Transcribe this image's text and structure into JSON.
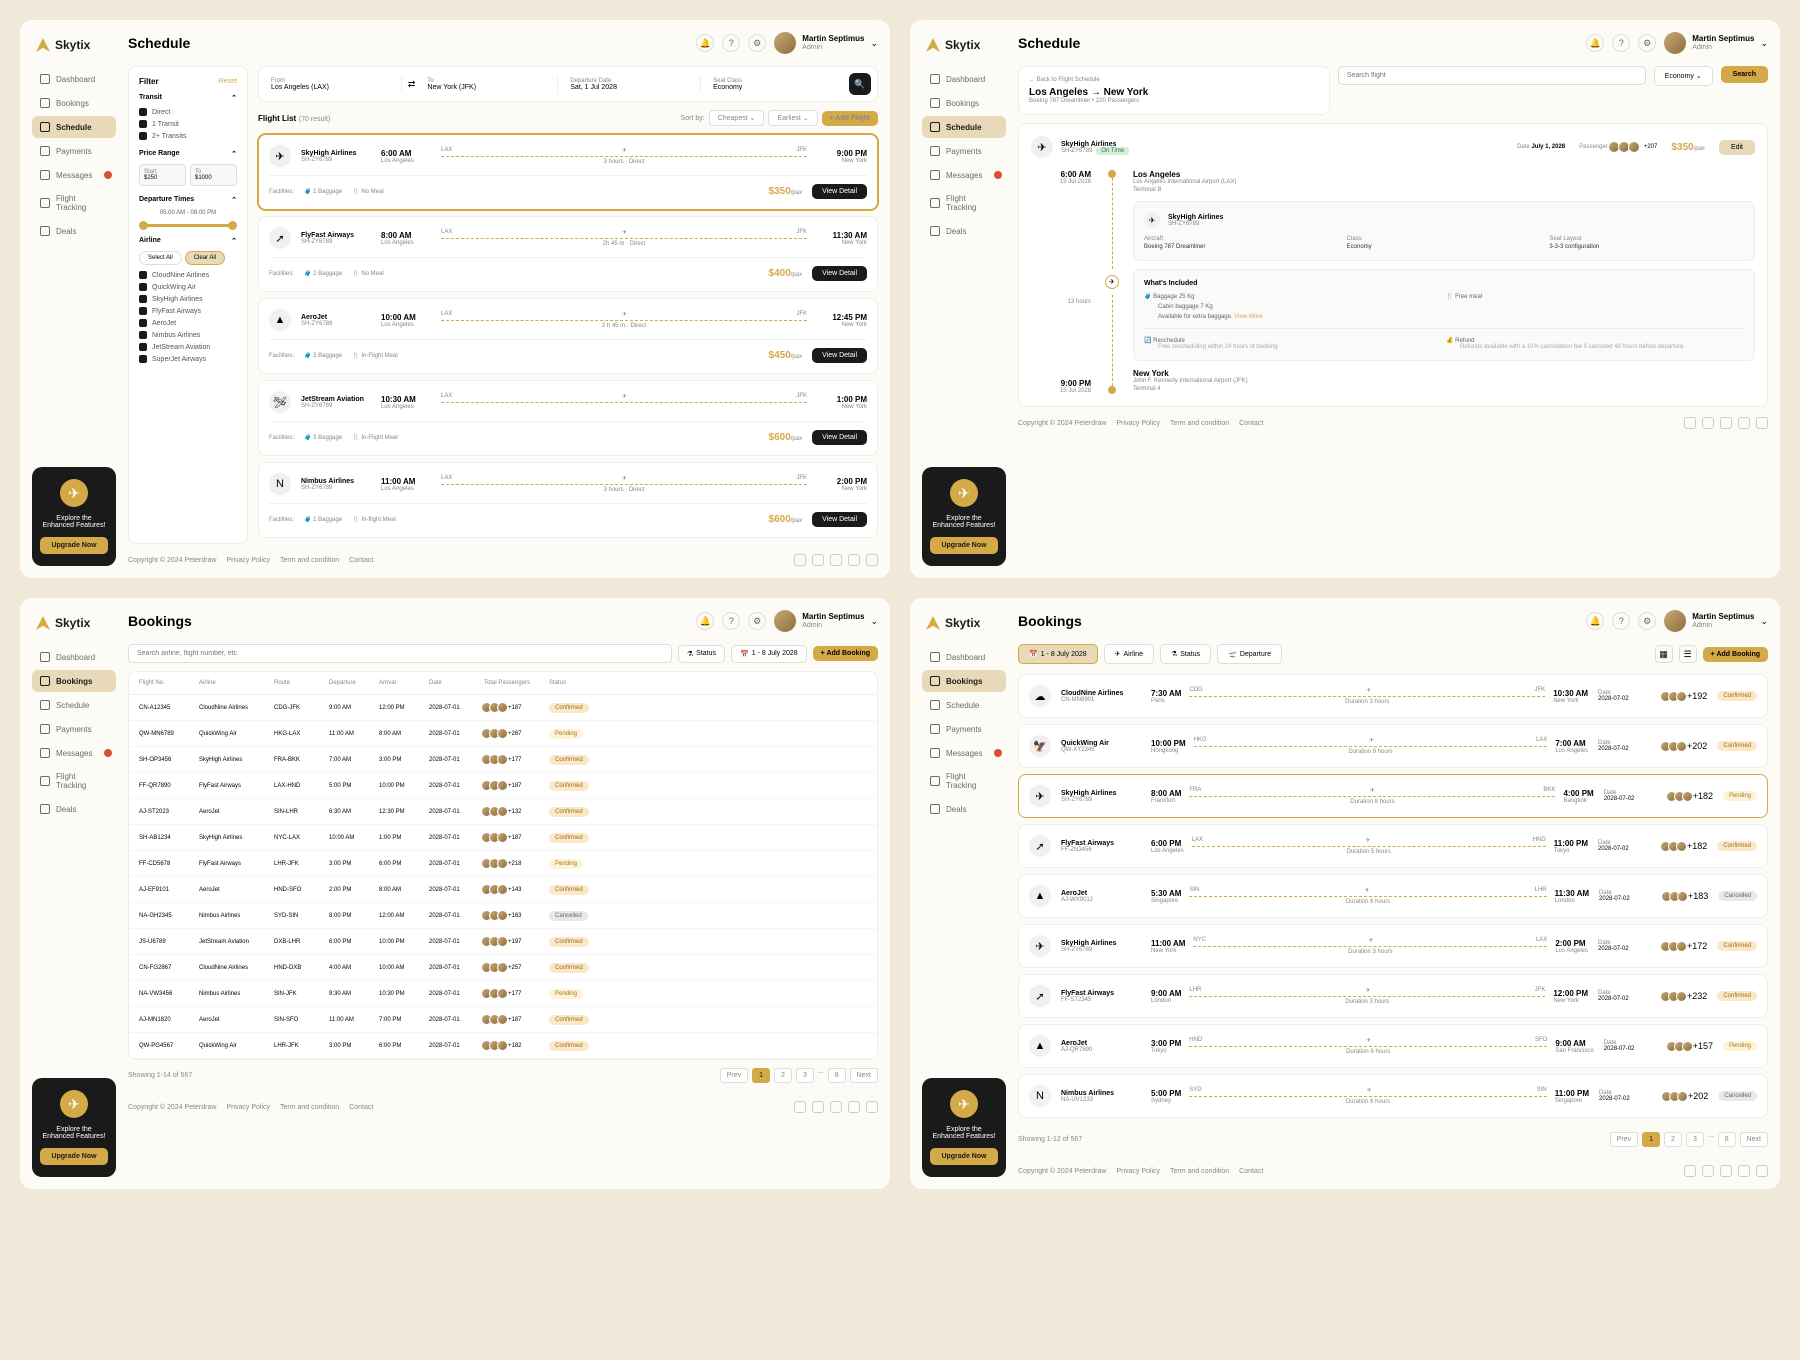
{
  "brand": "Skytix",
  "user": {
    "name": "Martin Septimus",
    "role": "Admin"
  },
  "nav": {
    "dashboard": "Dashboard",
    "bookings": "Bookings",
    "schedule": "Schedule",
    "payments": "Payments",
    "messages": "Messages",
    "flightTracking": "Flight Tracking",
    "deals": "Deals"
  },
  "promo": {
    "title": "Explore the Enhanced Features!",
    "cta": "Upgrade Now"
  },
  "footer": {
    "copyright": "Copyright © 2024 Peterdraw",
    "privacy": "Privacy Policy",
    "terms": "Term and condition",
    "contact": "Contact"
  },
  "schedule": {
    "title": "Schedule",
    "search": {
      "fromLabel": "From",
      "fromValue": "Los Angeles (LAX)",
      "toLabel": "To",
      "toValue": "New York (JFK)",
      "dateLabel": "Departure Date",
      "dateValue": "Sat, 1 Jul 2028",
      "classLabel": "Seat Class",
      "classValue": "Economy"
    },
    "filter": {
      "title": "Filter",
      "reset": "Reset",
      "transit": {
        "title": "Transit",
        "direct": "Direct",
        "one": "1 Transit",
        "two": "2+ Transits"
      },
      "priceRange": {
        "title": "Price Range",
        "startLabel": "Start",
        "start": "$250",
        "endLabel": "To",
        "end": "$1000"
      },
      "depTimes": {
        "title": "Departure Times",
        "range": "05.00 AM - 08.00 PM"
      },
      "airline": {
        "title": "Airline",
        "selectAll": "Select All",
        "clearAll": "Clear All",
        "items": [
          "CloudNine Airlines",
          "QuickWing Air",
          "SkyHigh Airlines",
          "FlyFast Airways",
          "AeroJet",
          "Nimbus Airlines",
          "JetStream Aviation",
          "SuperJet Airways"
        ]
      }
    },
    "list": {
      "title": "Flight List",
      "countLabel": "(70 result)",
      "sortLabel": "Sort by:",
      "cheapest": "Cheapest",
      "earliest": "Earliest",
      "addFlight": "+ Add Flight",
      "facilitiesLabel": "Facilities:",
      "flights": [
        {
          "logo": "✈",
          "name": "SkyHigh Airlines",
          "code": "SH-ZY6789",
          "depTime": "6:00 AM",
          "depCity": "Los Angeles",
          "arrTime": "9:00 PM",
          "arrCity": "New York",
          "from": "LAX",
          "to": "JFK",
          "duration": "3 hours",
          "stops": "Direct",
          "price": "$350",
          "bag": "1 Baggage",
          "meal": "No Meal",
          "h": true
        },
        {
          "logo": "➚",
          "name": "FlyFast Airways",
          "code": "SH-ZY6789",
          "depTime": "8:00 AM",
          "depCity": "Los Angeles",
          "arrTime": "11:30 AM",
          "arrCity": "New York",
          "from": "LAX",
          "to": "JFK",
          "duration": "2h 45 m",
          "stops": "Direct",
          "price": "$400",
          "bag": "2 Baggage",
          "meal": "No Meal"
        },
        {
          "logo": "▲",
          "name": "AeroJet",
          "code": "SH-ZY6789",
          "depTime": "10:00 AM",
          "depCity": "Los Angeles",
          "arrTime": "12:45 PM",
          "arrCity": "New York",
          "from": "LAX",
          "to": "JFK",
          "duration": "2 h 45 m",
          "stops": "Direct",
          "price": "$450",
          "bag": "3 Baggage",
          "meal": "In-Flight Meal"
        },
        {
          "logo": "🛩",
          "name": "JetStream Aviation",
          "code": "SH-ZY6789",
          "depTime": "10:30 AM",
          "depCity": "Los Angeles",
          "arrTime": "1:00 PM",
          "arrCity": "New York",
          "from": "LAX",
          "to": "JFK",
          "duration": "",
          "stops": "",
          "price": "$600",
          "bag": "3 Baggage",
          "meal": "In-Flight Meal"
        },
        {
          "logo": "N",
          "name": "Nimbus Airlines",
          "code": "SH-ZY6789",
          "depTime": "11:00 AM",
          "depCity": "Los Angeles",
          "arrTime": "2:00 PM",
          "arrCity": "New York",
          "from": "LAX",
          "to": "JFK",
          "duration": "3 hours",
          "stops": "Direct",
          "price": "$600",
          "bag": "1 Baggage",
          "meal": "In-flight Meal"
        }
      ],
      "detailBtn": "View Detail",
      "per": "/pax"
    }
  },
  "scheduleDetail": {
    "back": "← Back to Flight Schedule",
    "route": "Los Angeles → New York",
    "meta": "Boeing 787 Dreamliner • 220 Passengers",
    "searchPlaceholder": "Search flight",
    "classBtn": "Economy",
    "searchBtn": "Search",
    "airline": "SkyHigh Airlines",
    "code": "SH-ZY6789",
    "status": "On Time",
    "dateLabel": "Date",
    "date": "July 1, 2028",
    "paxLabel": "Passenger",
    "paxCount": "+207",
    "price": "$350",
    "per": "/pax",
    "edit": "Edit",
    "timeline": {
      "dep": {
        "time": "6:00 AM",
        "date": "15 Jul 2028",
        "city": "Los Angeles",
        "airport": "Los Angeles International Airport (LAX)",
        "terminal": "Terminal B"
      },
      "duration": "13 hours",
      "arr": {
        "time": "9:00 PM",
        "date": "15 Jul 2028",
        "city": "New York",
        "airport": "John F. Kennedy International Airport (JFK)",
        "terminal": "Terminal 4"
      }
    },
    "info": {
      "airline": "SkyHigh Airlines",
      "code": "SH-ZY6789",
      "aircraftLabel": "Aircraft",
      "aircraft": "Boeing 787 Dreamliner",
      "classLabel": "Class",
      "class": "Economy",
      "seatLabel": "Seat Layout",
      "seat": "3-3-3 configuration"
    },
    "included": {
      "title": "What's Included",
      "bag1": "Baggage 25 Kg",
      "bag2": "Cabin baggage 7 Kg",
      "extra": "Available for extra baggage.",
      "viewMore": "View More",
      "meal": "Free meal",
      "reschedule": "Reschedule",
      "rescheduleNote": "Free rescheduling within 24 hours of booking",
      "refund": "Refund",
      "refundNote": "Refunds available with a 10% cancellation fee if canceled 48 hours before departure"
    }
  },
  "bookings": {
    "title": "Bookings",
    "searchPlaceholder": "Search airline, flight number, etc",
    "statusFilter": "Status",
    "dateRange": "1 - 8 July 2028",
    "addBooking": "+ Add Booking",
    "headers": {
      "flight": "Flight No.",
      "airline": "Airline",
      "route": "Route",
      "dep": "Departure",
      "arr": "Arrival",
      "date": "Date",
      "pax": "Total Passengers",
      "status": "Status"
    },
    "rows": [
      {
        "no": "CN-A12345",
        "airline": "CloudNine Airlines",
        "route": "CDG-JFK",
        "dep": "9:00 AM",
        "arr": "12:00 PM",
        "date": "2028-07-01",
        "pax": "+187",
        "status": "Confirmed"
      },
      {
        "no": "QW-MN6789",
        "airline": "QuickWing Air",
        "route": "HKG-LAX",
        "dep": "11:00 AM",
        "arr": "8:00 AM",
        "date": "2028-07-01",
        "pax": "+267",
        "status": "Pending"
      },
      {
        "no": "SH-OP3456",
        "airline": "SkyHigh Airlines",
        "route": "FRA-BKK",
        "dep": "7:00 AM",
        "arr": "3:00 PM",
        "date": "2028-07-01",
        "pax": "+177",
        "status": "Confirmed"
      },
      {
        "no": "FF-QR7890",
        "airline": "FlyFast Airways",
        "route": "LAX-HND",
        "dep": "5:00 PM",
        "arr": "10:00 PM",
        "date": "2028-07-01",
        "pax": "+187",
        "status": "Confirmed"
      },
      {
        "no": "AJ-ST2023",
        "airline": "AeroJet",
        "route": "SIN-LHR",
        "dep": "6:30 AM",
        "arr": "12:30 PM",
        "date": "2028-07-01",
        "pax": "+132",
        "status": "Confirmed"
      },
      {
        "no": "SH-AB1234",
        "airline": "SkyHigh Airlines",
        "route": "NYC-LAX",
        "dep": "10:00 AM",
        "arr": "1:00 PM",
        "date": "2028-07-01",
        "pax": "+187",
        "status": "Confirmed"
      },
      {
        "no": "FF-CD5678",
        "airline": "FlyFast Airways",
        "route": "LHR-JFK",
        "dep": "3:00 PM",
        "arr": "6:00 PM",
        "date": "2028-07-01",
        "pax": "+218",
        "status": "Pending"
      },
      {
        "no": "AJ-EF9101",
        "airline": "AeroJet",
        "route": "HND-SFO",
        "dep": "2:00 PM",
        "arr": "8:00 AM",
        "date": "2028-07-01",
        "pax": "+143",
        "status": "Confirmed"
      },
      {
        "no": "NA-GH2345",
        "airline": "Nimbus Airlines",
        "route": "SYD-SIN",
        "dep": "8:00 PM",
        "arr": "12:00 AM",
        "date": "2028-07-01",
        "pax": "+163",
        "status": "Cancelled"
      },
      {
        "no": "JS-U6789",
        "airline": "JetStream Aviation",
        "route": "DXB-LHR",
        "dep": "6:00 PM",
        "arr": "10:00 PM",
        "date": "2028-07-01",
        "pax": "+197",
        "status": "Confirmed"
      },
      {
        "no": "CN-FG2867",
        "airline": "CloudNine Airlines",
        "route": "HND-DXB",
        "dep": "4:00 AM",
        "arr": "10:00 AM",
        "date": "2028-07-01",
        "pax": "+257",
        "status": "Confirmed"
      },
      {
        "no": "NA-VW3456",
        "airline": "Nimbus Airlines",
        "route": "SIN-JFK",
        "dep": "9:30 AM",
        "arr": "10:30 PM",
        "date": "2028-07-01",
        "pax": "+177",
        "status": "Pending"
      },
      {
        "no": "AJ-MN1820",
        "airline": "AeroJet",
        "route": "SIN-SFO",
        "dep": "11:00 AM",
        "arr": "7:00 PM",
        "date": "2028-07-01",
        "pax": "+187",
        "status": "Confirmed"
      },
      {
        "no": "QW-PG4567",
        "airline": "QuickWing Air",
        "route": "LHR-JFK",
        "dep": "3:00 PM",
        "arr": "6:00 PM",
        "date": "2028-07-01",
        "pax": "+182",
        "status": "Confirmed"
      }
    ],
    "showing": "Showing 1-14 of 567",
    "prev": "Prev",
    "next": "Next"
  },
  "bookingsCards": {
    "title": "Bookings",
    "dateFilter": "1 - 8 July 2028",
    "filters": {
      "airline": "Airline",
      "status": "Status",
      "departure": "Departure"
    },
    "addBooking": "+ Add Booking",
    "dateLabel": "Date",
    "cards": [
      {
        "logo": "☁",
        "name": "CloudNine Airlines",
        "code": "CN-MN8901",
        "depTime": "7:30 AM",
        "depCity": "Paris",
        "arrTime": "10:30 AM",
        "arrCity": "New York",
        "from": "CDG",
        "to": "JFK",
        "dur": "Duration 3 hours",
        "date": "2028-07-02",
        "pax": "+192",
        "status": "Confirmed"
      },
      {
        "logo": "🦅",
        "name": "QuickWing Air",
        "code": "QW-XY2345",
        "depTime": "10:00 PM",
        "depCity": "Hongkong",
        "arrTime": "7:00 AM",
        "arrCity": "Los Angeles",
        "from": "HKG",
        "to": "LAX",
        "dur": "Duration 9 hours",
        "date": "2028-07-02",
        "pax": "+202",
        "status": "Confirmed"
      },
      {
        "logo": "✈",
        "name": "SkyHigh Airlines",
        "code": "SH-ZY6789",
        "depTime": "8:00 AM",
        "depCity": "Frankfurt",
        "arrTime": "4:00 PM",
        "arrCity": "Bangkok",
        "from": "FRA",
        "to": "BKK",
        "dur": "Duration 8 hours",
        "date": "2028-07-02",
        "pax": "+182",
        "status": "Pending",
        "h": true
      },
      {
        "logo": "➚",
        "name": "FlyFast Airways",
        "code": "FF-ZN3456",
        "depTime": "6:00 PM",
        "depCity": "Los Angeles",
        "arrTime": "11:00 PM",
        "arrCity": "Tokyo",
        "from": "LAX",
        "to": "HND",
        "dur": "Duration 5 hours",
        "date": "2028-07-02",
        "pax": "+182",
        "status": "Confirmed"
      },
      {
        "logo": "▲",
        "name": "AeroJet",
        "code": "AJ-WX9012",
        "depTime": "5:30 AM",
        "depCity": "Singapore",
        "arrTime": "11:30 AM",
        "arrCity": "London",
        "from": "SIN",
        "to": "LHR",
        "dur": "Duration 6 hours",
        "date": "2028-07-02",
        "pax": "+183",
        "status": "Cancelled"
      },
      {
        "logo": "✈",
        "name": "SkyHigh Airlines",
        "code": "SH-ZY6789",
        "depTime": "11:00 AM",
        "depCity": "New York",
        "arrTime": "2:00 PM",
        "arrCity": "Los Angeles",
        "from": "NYC",
        "to": "LAX",
        "dur": "Duration 3 hours",
        "date": "2028-07-02",
        "pax": "+172",
        "status": "Confirmed"
      },
      {
        "logo": "➚",
        "name": "FlyFast Airways",
        "code": "FF-ST2345",
        "depTime": "9:00 AM",
        "depCity": "London",
        "arrTime": "12:00 PM",
        "arrCity": "New York",
        "from": "LHR",
        "to": "JFK",
        "dur": "Duration 3 hours",
        "date": "2028-07-02",
        "pax": "+232",
        "status": "Confirmed"
      },
      {
        "logo": "▲",
        "name": "AeroJet",
        "code": "AJ-QR7890",
        "depTime": "3:00 PM",
        "depCity": "Tokyo",
        "arrTime": "9:00 AM",
        "arrCity": "San Francisco",
        "from": "HND",
        "to": "SFO",
        "dur": "Duration 6 hours",
        "date": "2028-07-02",
        "pax": "+157",
        "status": "Pending"
      },
      {
        "logo": "N",
        "name": "Nimbus Airlines",
        "code": "NA-UV1233",
        "depTime": "5:00 PM",
        "depCity": "Sydney",
        "arrTime": "11:00 PM",
        "arrCity": "Singapore",
        "from": "SYD",
        "to": "SIN",
        "dur": "Duration 6 hours",
        "date": "2028-07-02",
        "pax": "+202",
        "status": "Cancelled"
      }
    ],
    "showing": "Showing 1-12 of 567"
  }
}
